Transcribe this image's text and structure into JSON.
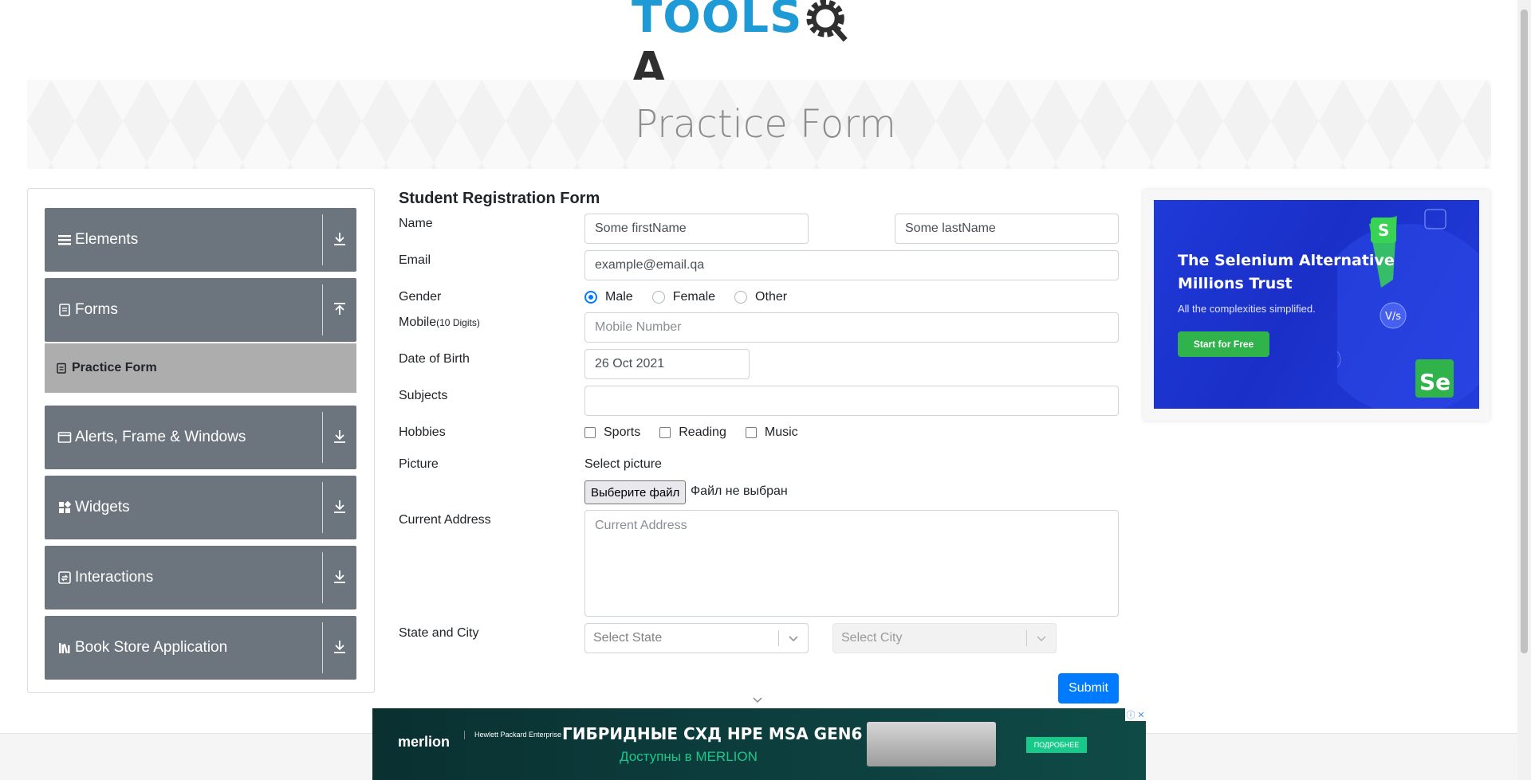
{
  "logo": {
    "part1": "TOOLS",
    "part2": "A"
  },
  "banner": {
    "title": "Practice Form"
  },
  "sidebar": {
    "groups": [
      {
        "label": "Elements",
        "icon": "hamburger-icon"
      },
      {
        "label": "Forms",
        "icon": "document-icon",
        "expanded": true,
        "sub_items": [
          {
            "label": "Practice Form"
          }
        ]
      },
      {
        "label": "Alerts, Frame & Windows",
        "icon": "window-icon"
      },
      {
        "label": "Widgets",
        "icon": "widgets-icon"
      },
      {
        "label": "Interactions",
        "icon": "interactions-icon"
      },
      {
        "label": "Book Store Application",
        "icon": "books-icon"
      }
    ]
  },
  "form": {
    "title": "Student Registration Form",
    "labels": {
      "name": "Name",
      "email": "Email",
      "gender": "Gender",
      "mobile": "Mobile",
      "mobile_hint": "(10 Digits)",
      "dob": "Date of Birth",
      "subjects": "Subjects",
      "hobbies": "Hobbies",
      "picture": "Picture",
      "address": "Current Address",
      "state_city": "State and City"
    },
    "first_name": "Some firstName",
    "last_name": "Some lastName",
    "email": "example@email.qa",
    "gender_options": [
      "Male",
      "Female",
      "Other"
    ],
    "gender_selected": "Male",
    "mobile_placeholder": "Mobile Number",
    "dob": "26 Oct 2021",
    "subjects": "",
    "hobbies": [
      "Sports",
      "Reading",
      "Music"
    ],
    "picture_label": "Select picture",
    "file_button": "Выберите файл",
    "file_status": "Файл не выбран",
    "address_placeholder": "Current Address",
    "state_placeholder": "Select State",
    "city_placeholder": "Select City",
    "submit": "Submit"
  },
  "ad_right": {
    "headline_1": "The Selenium Alternative",
    "headline_2": "Millions Trust",
    "subtitle": "All the complexities simplified.",
    "cta": "Start for Free",
    "colors": {
      "bg": "#1f3ad8",
      "cta": "#2fb34a"
    }
  },
  "ad_bottom": {
    "brand": "merlion",
    "partner": "Hewlett Packard Enterprise",
    "title": "ГИБРИДНЫЕ СХД HPE MSA GEN6",
    "subtitle": "Доступны в MERLION",
    "cta": "ПОДРОБНЕЕ"
  },
  "colors": {
    "logo_blue": "#1e9bd7",
    "menu_bg": "#6c757d",
    "submit_bg": "#007bff"
  }
}
